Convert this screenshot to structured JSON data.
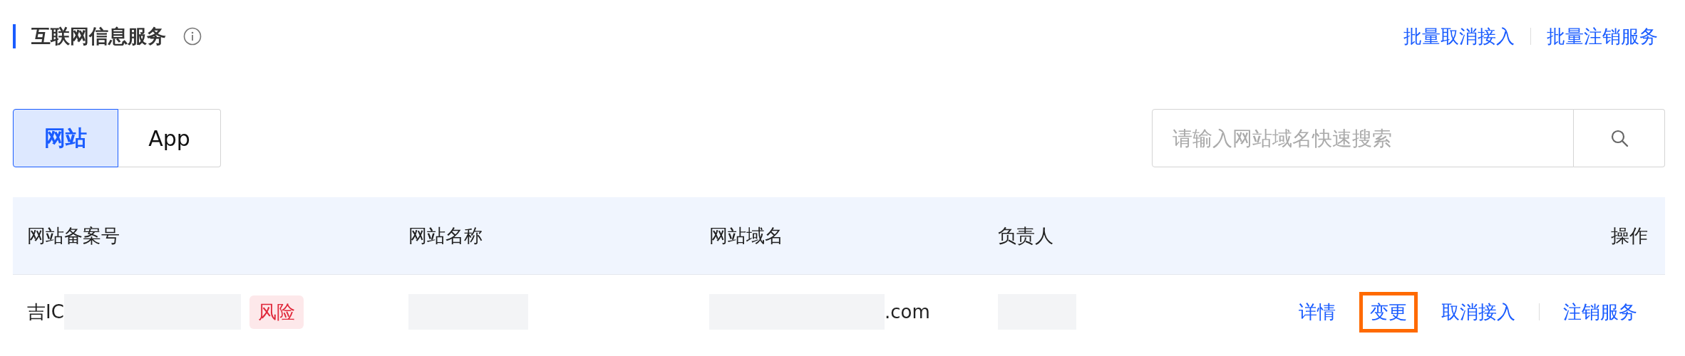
{
  "section": {
    "title": "互联网信息服务",
    "actions": [
      {
        "label": "批量取消接入"
      },
      {
        "label": "批量注销服务"
      }
    ]
  },
  "tabs": [
    {
      "label": "网站",
      "selected": true
    },
    {
      "label": "App",
      "selected": false
    }
  ],
  "search": {
    "placeholder": "请输入网站域名快速搜索"
  },
  "table": {
    "columns": [
      "网站备案号",
      "网站名称",
      "网站域名",
      "负责人",
      "操作"
    ],
    "rows": [
      {
        "record_no": "吉IC",
        "tag": "风险",
        "name": "",
        "domain": ".com",
        "actions": [
          {
            "label": "详情",
            "highlighted": false
          },
          {
            "label": "变更",
            "highlighted": true
          },
          {
            "label": "取消接入",
            "highlighted": false
          },
          {
            "label": "注销服务",
            "highlighted": false
          }
        ]
      }
    ]
  }
}
